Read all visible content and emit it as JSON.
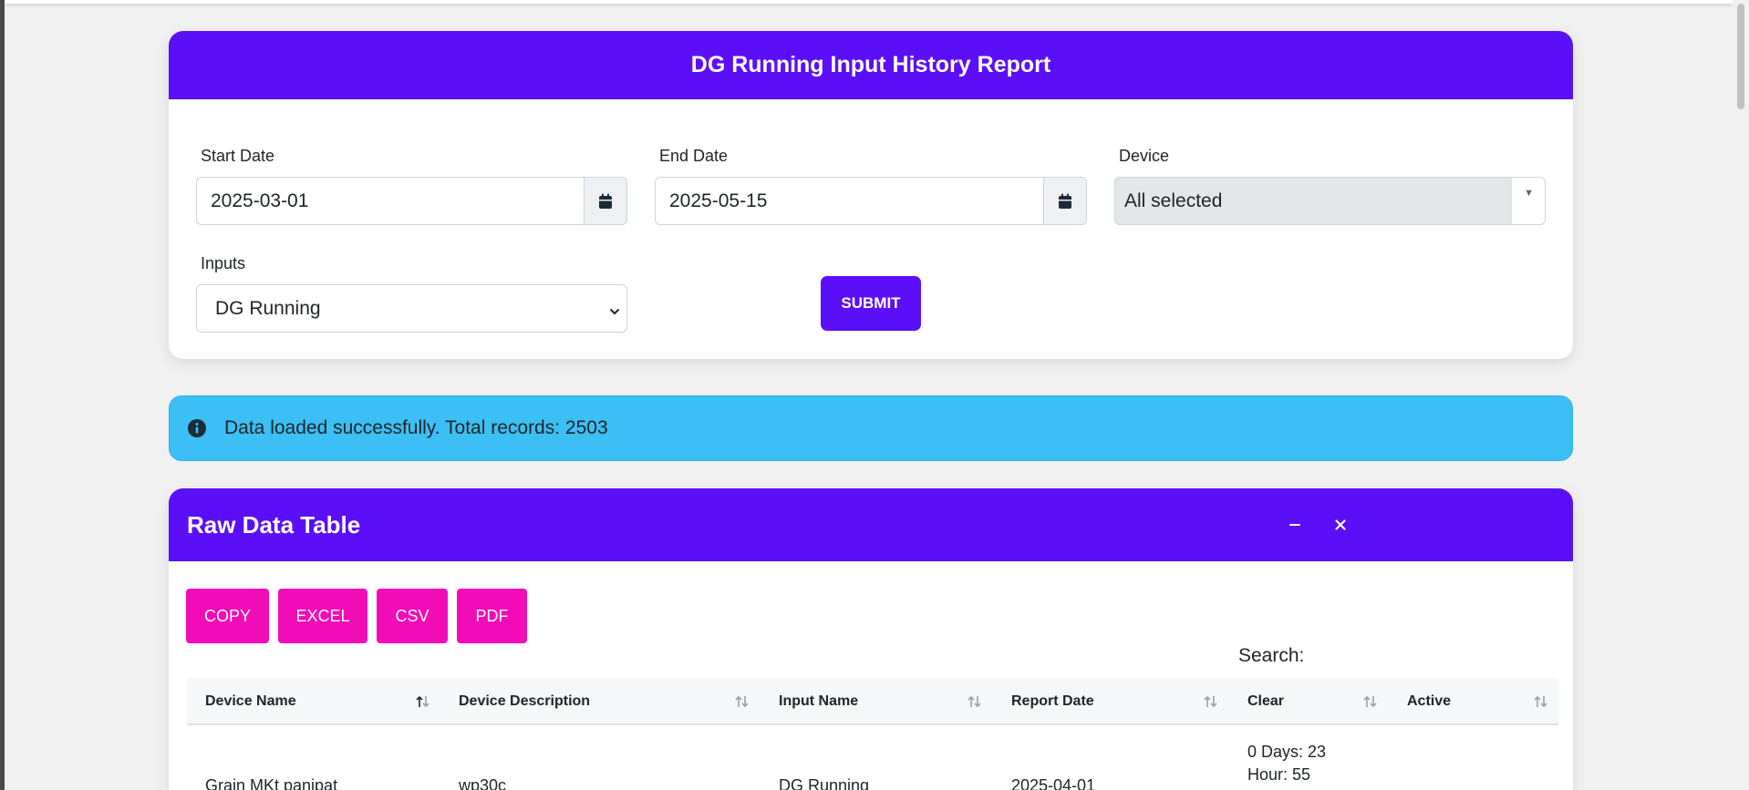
{
  "report": {
    "title": "DG Running Input History Report",
    "start_date_label": "Start Date",
    "start_date_value": "2025-03-01",
    "end_date_label": "End Date",
    "end_date_value": "2025-05-15",
    "device_label": "Device",
    "device_value": "All selected",
    "inputs_label": "Inputs",
    "inputs_value": "DG Running",
    "submit_label": "SUBMIT"
  },
  "alert": {
    "message": "Data loaded successfully. Total records: 2503"
  },
  "table_card": {
    "title": "Raw Data Table",
    "buttons": [
      "COPY",
      "EXCEL",
      "CSV",
      "PDF"
    ],
    "search_label": "Search:",
    "columns": [
      "Device Name",
      "Device Description",
      "Input Name",
      "Report Date",
      "Clear",
      "Active"
    ],
    "rows": [
      {
        "device_name": "Grain MKt panipat",
        "device_description": "wp30c",
        "input_name": "DG Running",
        "report_date": "2025-04-01",
        "clear_line1": "0 Days: 23",
        "clear_line2": "Hour: 55",
        "active": ""
      }
    ]
  },
  "colors": {
    "primary": "#5b0ff8",
    "export_button": "#f20cb8",
    "alert_bg": "#3bbff5"
  }
}
